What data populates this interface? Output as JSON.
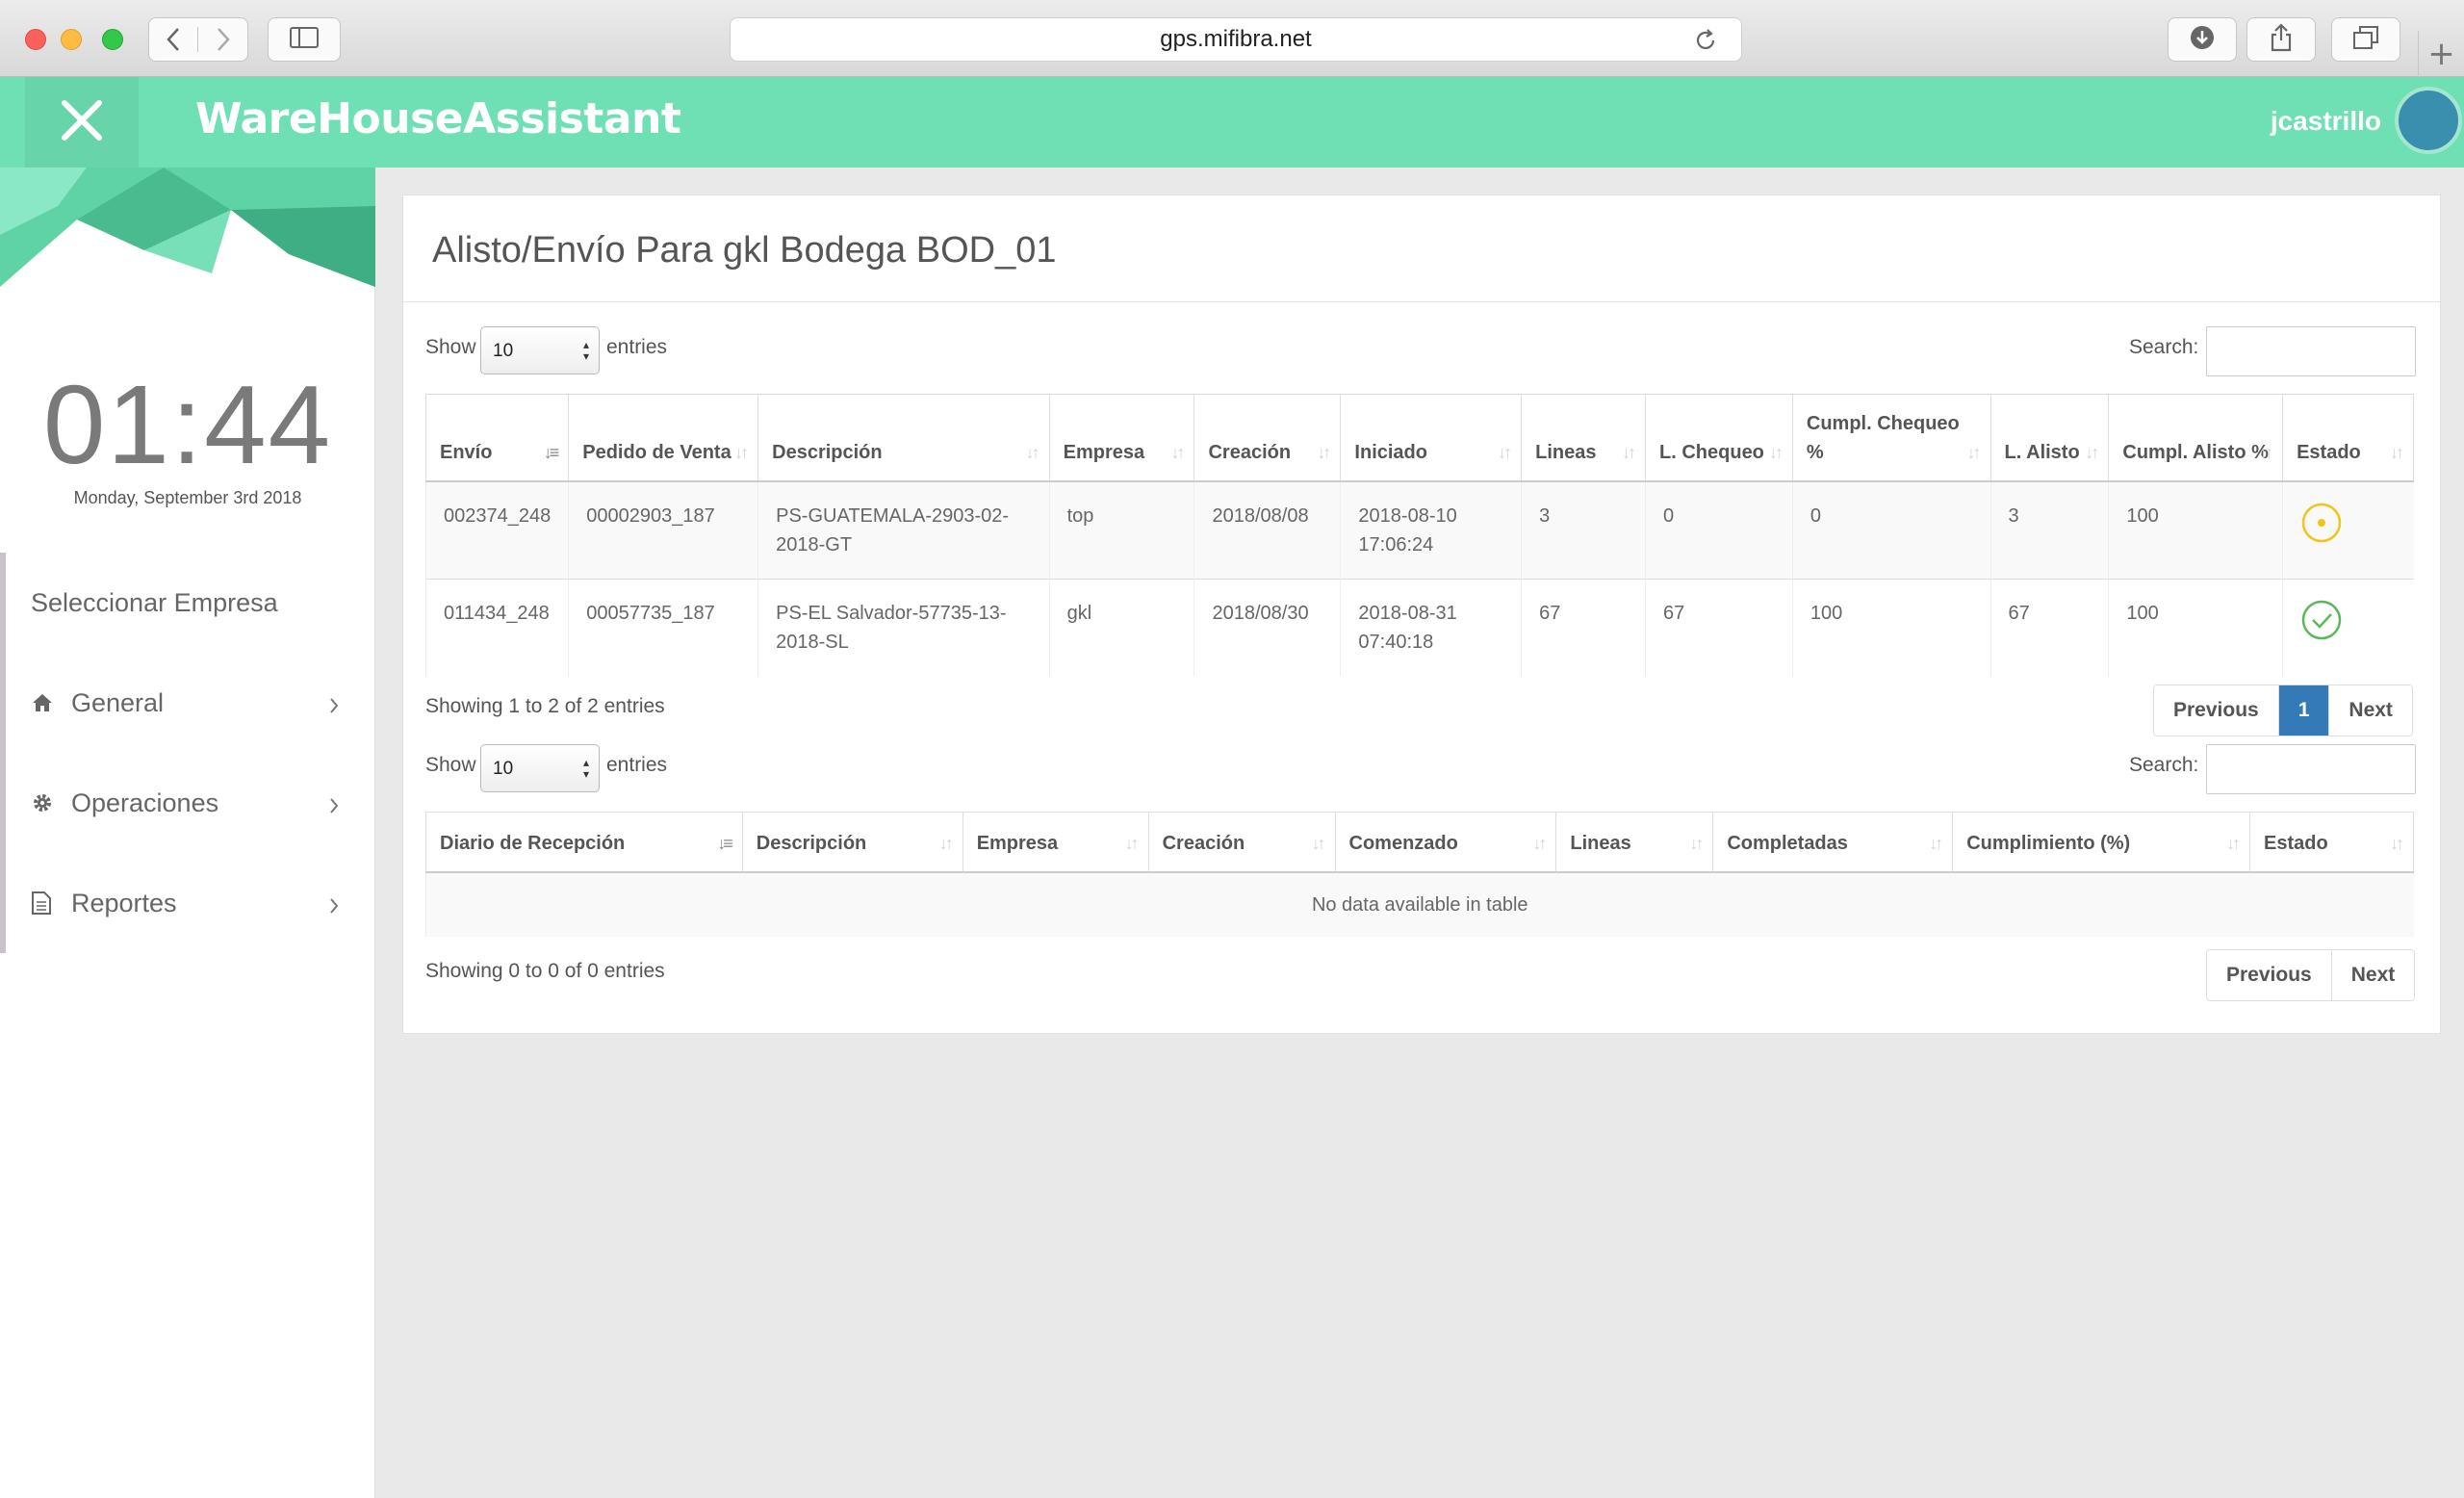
{
  "browser": {
    "url": "gps.mifibra.net"
  },
  "header": {
    "brand": "WareHouseAssistant",
    "user": "jcastrillo"
  },
  "sidebar": {
    "clock": "01:44",
    "date": "Monday, September 3rd 2018",
    "items": [
      {
        "label": "Seleccionar Empresa",
        "icon": ""
      },
      {
        "label": "General",
        "icon": "home-icon"
      },
      {
        "label": "Operaciones",
        "icon": "gear-icon"
      },
      {
        "label": "Reportes",
        "icon": "document-icon"
      }
    ]
  },
  "panel": {
    "title": "Alisto/Envío Para gkl Bodega BOD_01"
  },
  "table1": {
    "show_label": "Show",
    "entries_label": "entries",
    "length_value": "10",
    "search_label": "Search:",
    "headers": [
      "Envío",
      "Pedido de Venta",
      "Descripción",
      "Empresa",
      "Creación",
      "Iniciado",
      "Lineas",
      "L. Chequeo",
      "Cumpl. Chequeo %",
      "L. Alisto",
      "Cumpl. Alisto %",
      "Estado"
    ],
    "rows": [
      {
        "envio": "002374_248",
        "pedido": "00002903_187",
        "descripcion": "PS-GUATEMALA-2903-02-2018-GT",
        "empresa": "top",
        "creacion": "2018/08/08",
        "iniciado": "2018-08-10 17:06:24",
        "lineas": "3",
        "l_chequeo": "0",
        "cumpl_chequeo": "0",
        "l_alisto": "3",
        "cumpl_alisto": "100",
        "estado": "in-progress-icon"
      },
      {
        "envio": "011434_248",
        "pedido": "00057735_187",
        "descripcion": "PS-EL Salvador-57735-13-2018-SL",
        "empresa": "gkl",
        "creacion": "2018/08/30",
        "iniciado": "2018-08-31 07:40:18",
        "lineas": "67",
        "l_chequeo": "67",
        "cumpl_chequeo": "100",
        "l_alisto": "67",
        "cumpl_alisto": "100",
        "estado": "check-circle-icon"
      }
    ],
    "info": "Showing 1 to 2 of 2 entries",
    "pager": {
      "previous": "Previous",
      "page": "1",
      "next": "Next"
    }
  },
  "table2": {
    "show_label": "Show",
    "entries_label": "entries",
    "length_value": "10",
    "search_label": "Search:",
    "headers": [
      "Diario de Recepción",
      "Descripción",
      "Empresa",
      "Creación",
      "Comenzado",
      "Lineas",
      "Completadas",
      "Cumplimiento (%)",
      "Estado"
    ],
    "empty": "No data available in table",
    "info": "Showing 0 to 0 of 0 entries",
    "pager": {
      "previous": "Previous",
      "next": "Next"
    }
  },
  "colors": {
    "header": "#6fdfb4",
    "accent": "#337ab7",
    "pending": "#f0c419",
    "done": "#5cb85c"
  }
}
